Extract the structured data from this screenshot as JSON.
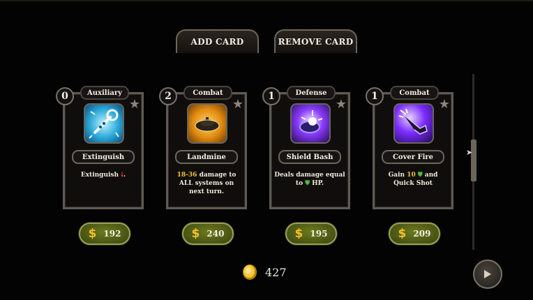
{
  "tabs": {
    "add_label": "ADD CARD",
    "remove_label": "REMOVE CARD"
  },
  "cards": [
    {
      "cost": "0",
      "type": "Auxiliary",
      "name": "Extinguish",
      "desc_pre": "Extinguish",
      "desc_icon": "fire-down-arrow-icon",
      "desc_post": ".",
      "price": "192",
      "art": "wrench-ice-icon"
    },
    {
      "cost": "2",
      "type": "Combat",
      "name": "Landmine",
      "desc_hl": "18-36",
      "desc_post": "damage to ALL systems on next turn.",
      "price": "240",
      "art": "landmine-icon"
    },
    {
      "cost": "1",
      "type": "Defense",
      "name": "Shield Bash",
      "desc_pre": "Deals damage equal to",
      "desc_icon": "shield-icon",
      "desc_post": "HP.",
      "price": "195",
      "art": "shield-bash-icon"
    },
    {
      "cost": "1",
      "type": "Combat",
      "name": "Cover Fire",
      "desc_pre": "Gain",
      "desc_hl": "10",
      "desc_icon": "shield-icon",
      "desc_post": "and Quick Shot",
      "price": "209",
      "art": "cover-fire-gun-icon"
    }
  ],
  "currency_symbol": "$",
  "gold": "427",
  "colors": {
    "price_pill": "#5a6a18",
    "dollar": "#f3c12e",
    "highlight": "#f0c040"
  }
}
